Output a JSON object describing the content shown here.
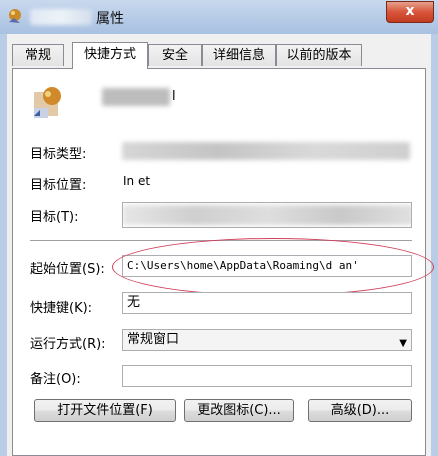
{
  "window": {
    "title": "属性",
    "close_label": "x"
  },
  "tabs": [
    {
      "label": "常规",
      "active": false
    },
    {
      "label": "快捷方式",
      "active": true
    },
    {
      "label": "安全",
      "active": false
    },
    {
      "label": "详细信息",
      "active": false
    },
    {
      "label": "以前的版本",
      "active": false
    }
  ],
  "shortcut": {
    "name_suffix": "l",
    "target_type_label": "目标类型:",
    "target_location_label": "目标位置:",
    "target_location_value": "In  et",
    "target_label": "目标(T):",
    "start_in_label": "起始位置(S):",
    "start_in_value": "C:\\Users\\home\\AppData\\Roaming\\d    an'",
    "hotkey_label": "快捷键(K):",
    "hotkey_value": "无",
    "run_label": "运行方式(R):",
    "run_value": "常规窗口",
    "comment_label": "备注(O):",
    "comment_value": ""
  },
  "buttons": {
    "open_location": "打开文件位置(F)",
    "change_icon": "更改图标(C)...",
    "advanced": "高级(D)..."
  },
  "colors": {
    "highlight_ellipse": "#d0405a",
    "titlebar": "#b5cae6"
  }
}
